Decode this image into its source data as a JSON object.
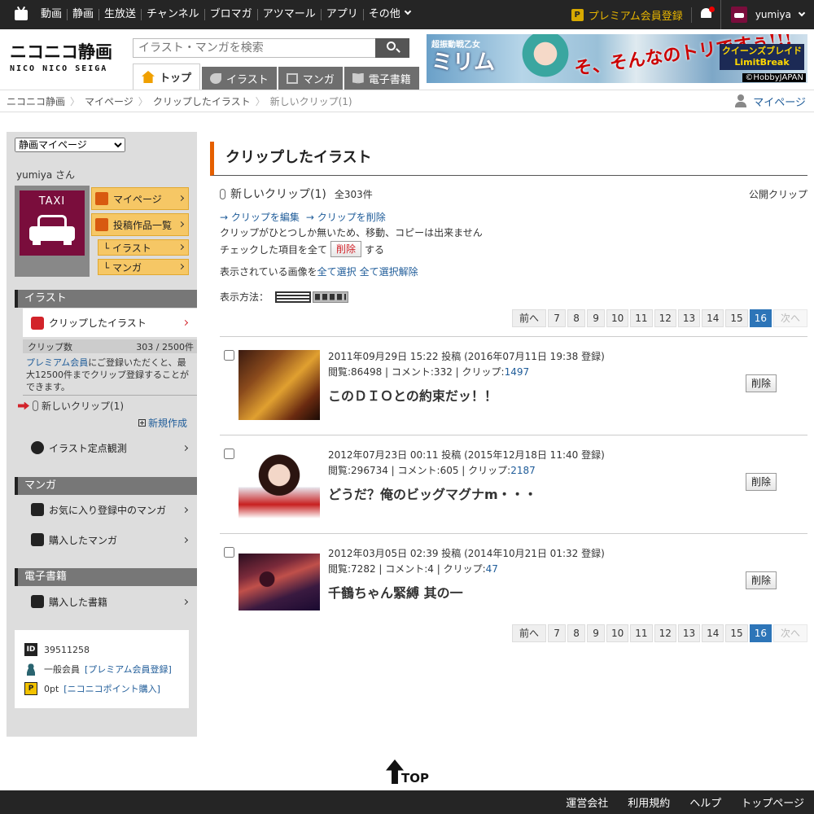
{
  "globalbar": {
    "nav": [
      "動画",
      "静画",
      "生放送",
      "チャンネル",
      "ブロマガ",
      "アツマール",
      "アプリ",
      "その他"
    ],
    "premium_label": "プレミアム会員登録",
    "premium_icon": "P",
    "username": "yumiya"
  },
  "header": {
    "logo_jp": "ニコニコ静画",
    "logo_en": "NICO NICO SEIGA",
    "search_placeholder": "イラスト・マンガを検索",
    "tabs": [
      {
        "label": "トップ",
        "icon": "home-icon",
        "active": true
      },
      {
        "label": "イラスト",
        "icon": "pen-icon",
        "active": false
      },
      {
        "label": "マンガ",
        "icon": "manga-icon",
        "active": false
      },
      {
        "label": "電子書籍",
        "icon": "book-icon",
        "active": false
      }
    ],
    "banner": {
      "line1": "超振動戦乙女",
      "line2": "ミリム",
      "line3": "そ、そんなのトリですぅ!!!",
      "logo": "クイーンズブレイド LimitBreak",
      "credit": "©HobbyJAPAN"
    }
  },
  "breadcrumb": {
    "items": [
      "ニコニコ静画",
      "マイページ",
      "クリップしたイラスト",
      "新しいクリップ(1)"
    ],
    "mypage_label": "マイページ"
  },
  "sidebar": {
    "select_value": "静画マイページ",
    "username_label": "yumiya さん",
    "avatar_text": "TAXI",
    "buttons": {
      "mypage": "マイページ",
      "posts": "投稿作品一覧",
      "illust": "└ イラスト",
      "manga": "└ マンガ"
    },
    "illust_section": "イラスト",
    "clipped_illust": "クリップしたイラスト",
    "clip_count_label": "クリップ数",
    "clip_count_value": "303 / 2500件",
    "premium_link": "プレミアム会員",
    "premium_note": "にご登録いただくと、最大12500件までクリップ登録することができます。",
    "new_clip": "新しいクリップ(1)",
    "new_create": "新規作成",
    "fixed_point": "イラスト定点観測",
    "manga_section": "マンガ",
    "fav_manga": "お気に入り登録中のマンガ",
    "bought_manga": "購入したマンガ",
    "ebook_section": "電子書籍",
    "bought_books": "購入した書籍",
    "user_id": "39511258",
    "member_type": "一般会員",
    "member_link": "[プレミアム会員登録]",
    "points": "0pt",
    "points_link": "[ニコニコポイント購入]"
  },
  "main": {
    "title": "クリップしたイラスト",
    "clip_name": "新しいクリップ(1)",
    "clip_total": "全303件",
    "public_label": "公開クリップ",
    "edit_link": "→ クリップを編集",
    "delete_link": "→ クリップを削除",
    "note": "クリップがひとつしか無いため、移動、コピーは出来ません",
    "check_prefix": "チェックした項目を全て",
    "check_delete": "削除",
    "check_suffix": "する",
    "select_prefix": "表示されている画像を",
    "select_all": "全て選択",
    "deselect_all": "全て選択解除",
    "view_label": "表示方法：",
    "pager": {
      "prev": "前へ",
      "pages": [
        "7",
        "8",
        "9",
        "10",
        "11",
        "12",
        "13",
        "14",
        "15",
        "16"
      ],
      "current": "16",
      "next": "次へ"
    },
    "items": [
      {
        "posted": "2011年09月29日 15:22 投稿 (2016年07月11日 19:38 登録)",
        "stats_prefix": "閲覧:86498 | コメント:332 | クリップ:",
        "clips": "1497",
        "title": "このＤＩＯとの約束だッ！！",
        "delete": "削除"
      },
      {
        "posted": "2012年07月23日 00:11 投稿 (2015年12月18日 11:40 登録)",
        "stats_prefix": "閲覧:296734 | コメント:605 | クリップ:",
        "clips": "2187",
        "title": "どうだ？俺のビッグマグナm・・・",
        "delete": "削除"
      },
      {
        "posted": "2012年03月05日 02:39 投稿 (2014年10月21日 01:32 登録)",
        "stats_prefix": "閲覧:7282 | コメント:4 | クリップ:",
        "clips": "47",
        "title": "千鶴ちゃん緊縛 其の一",
        "delete": "削除"
      }
    ]
  },
  "footer": {
    "totop": "TOP",
    "links": [
      "運営会社",
      "利用規約",
      "ヘルプ",
      "トップページ"
    ]
  },
  "colors": {
    "accent": "#e55f00",
    "pager_current": "#2d75b8",
    "link": "#1f5c99",
    "bar": "#252525",
    "premium": "#e8b500"
  }
}
